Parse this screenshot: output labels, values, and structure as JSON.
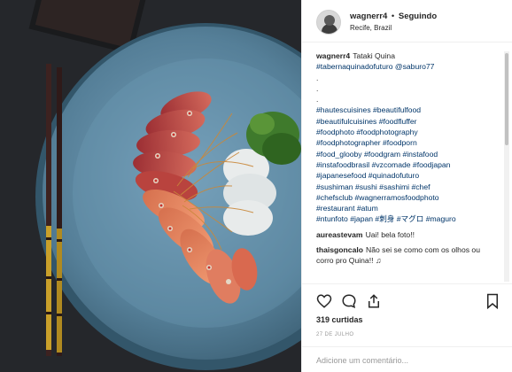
{
  "post": {
    "username": "wagnerr4",
    "separator": "•",
    "follow_status": "Seguindo",
    "location": "Recife, Brazil",
    "avatar_icon": "user-avatar-icon",
    "image_alt": "tataki-plate-photo"
  },
  "caption": {
    "author": "wagnerr4",
    "lines": [
      "Tataki Quina",
      "#tabernaquinadofuturo @saburo77",
      ".",
      ".",
      ".",
      "#hautescuisines #beautifulfood",
      "#beautifulcuisines #foodfluffer",
      "#foodphoto #foodphotography",
      "#foodphotographer #foodporn",
      "#food_glooby #foodgram #instafood",
      "#instafoodbrasil #vzcomade #foodjapan",
      "#japanesefood #quinadofuturo",
      "#sushiman #sushi #sashimi #chef",
      "#chefsclub #wagnerramosfoodphoto",
      "#restaurant #atum",
      "#ntunfoto #japan #刺身 #マグロ #maguro"
    ]
  },
  "comments": [
    {
      "author": "aureastevam",
      "text": "Uai! bela foto!!"
    },
    {
      "author": "thaisgoncalo",
      "text": "Não sei se como com os olhos ou corro pro Quina!! ♫"
    }
  ],
  "actions": {
    "like_icon": "heart-icon",
    "comment_icon": "comment-bubble-icon",
    "share_icon": "share-icon",
    "save_icon": "bookmark-icon",
    "likes_text": "319 curtidas",
    "date_text": "27 DE JULHO"
  },
  "add_comment": {
    "placeholder": "Adicione um comentário..."
  },
  "colors": {
    "link": "#003569",
    "plate": "#4f7d99",
    "background": "#26292c",
    "tuna": "#c8524a"
  }
}
